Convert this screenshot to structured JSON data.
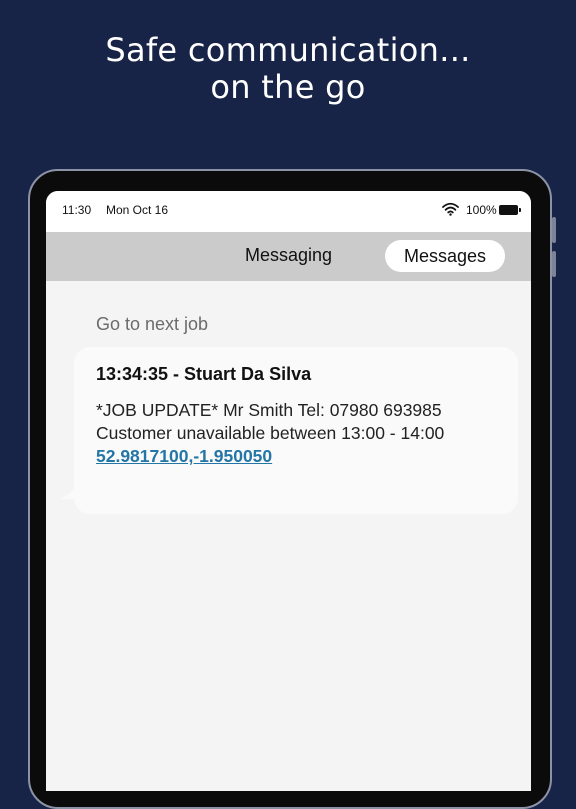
{
  "headline": {
    "line1": "Safe communication...",
    "line2": "on the go"
  },
  "statusbar": {
    "time": "11:30",
    "date": "Mon Oct 16",
    "battery_percent": "100%",
    "battery_level": 1.0
  },
  "navbar": {
    "title": "Messaging",
    "active_pill": "Messages"
  },
  "section_label": "Go to next job",
  "message": {
    "header": "13:34:35 - Stuart Da Silva",
    "line1": "*JOB UPDATE* Mr Smith Tel: 07980 693985",
    "line2": "Customer unavailable between 13:00 - 14:00",
    "link": "52.9817100,-1.950050"
  },
  "colors": {
    "background": "#172447",
    "screen": "#f4f4f4",
    "navbar": "#cbcbcb",
    "link": "#2376a6"
  },
  "icons": {
    "wifi": "wifi-icon",
    "battery": "battery-icon"
  }
}
